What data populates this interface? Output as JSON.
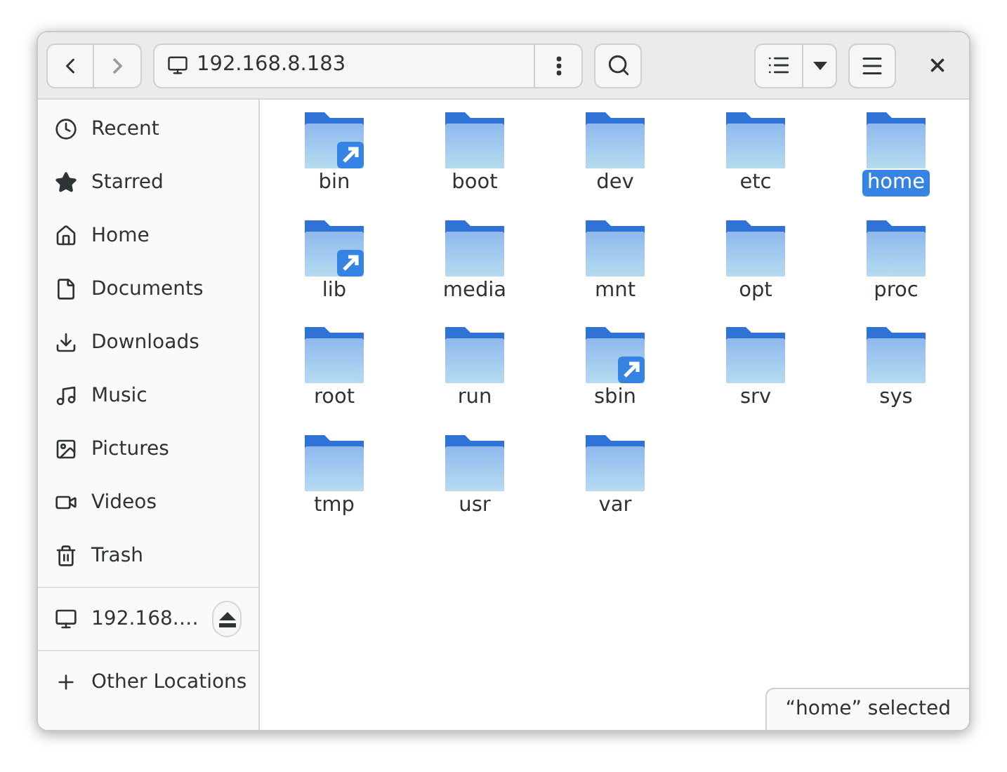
{
  "header": {
    "location": "192.168.8.183",
    "back_disabled": false,
    "forward_disabled": true
  },
  "sidebar": {
    "places": [
      {
        "label": "Recent",
        "selected": false
      },
      {
        "label": "Starred",
        "selected": false
      },
      {
        "label": "Home",
        "selected": false
      },
      {
        "label": "Documents",
        "selected": false
      },
      {
        "label": "Downloads",
        "selected": false
      },
      {
        "label": "Music",
        "selected": false
      },
      {
        "label": "Pictures",
        "selected": false
      },
      {
        "label": "Videos",
        "selected": false
      },
      {
        "label": "Trash",
        "selected": false
      }
    ],
    "mounts": [
      {
        "label": "192.168.…",
        "selected": false
      }
    ],
    "other": [
      {
        "label": "Other Locations",
        "selected": false
      }
    ]
  },
  "files": [
    {
      "name": "bin",
      "symlink": true,
      "selected": false
    },
    {
      "name": "boot",
      "symlink": false,
      "selected": false
    },
    {
      "name": "dev",
      "symlink": false,
      "selected": false
    },
    {
      "name": "etc",
      "symlink": false,
      "selected": false
    },
    {
      "name": "home",
      "symlink": false,
      "selected": true
    },
    {
      "name": "lib",
      "symlink": true,
      "selected": false
    },
    {
      "name": "media",
      "symlink": false,
      "selected": false
    },
    {
      "name": "mnt",
      "symlink": false,
      "selected": false
    },
    {
      "name": "opt",
      "symlink": false,
      "selected": false
    },
    {
      "name": "proc",
      "symlink": false,
      "selected": false
    },
    {
      "name": "root",
      "symlink": false,
      "selected": false
    },
    {
      "name": "run",
      "symlink": false,
      "selected": false
    },
    {
      "name": "sbin",
      "symlink": true,
      "selected": false
    },
    {
      "name": "srv",
      "symlink": false,
      "selected": false
    },
    {
      "name": "sys",
      "symlink": false,
      "selected": false
    },
    {
      "name": "tmp",
      "symlink": false,
      "selected": false
    },
    {
      "name": "usr",
      "symlink": false,
      "selected": false
    },
    {
      "name": "var",
      "symlink": false,
      "selected": false
    }
  ],
  "status": "“home” selected"
}
